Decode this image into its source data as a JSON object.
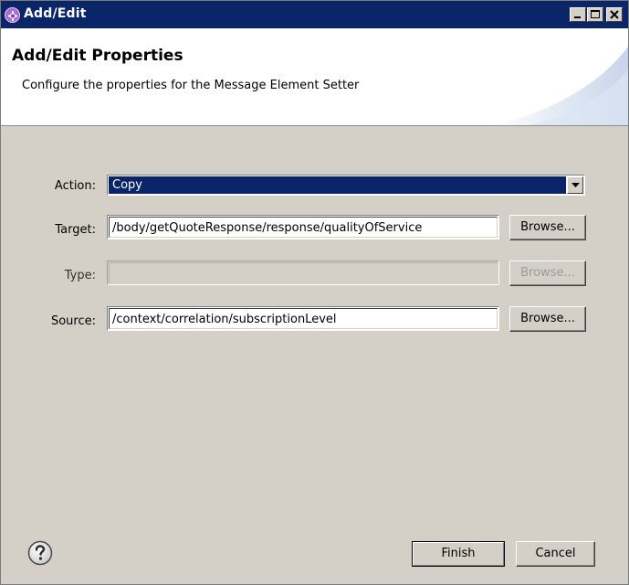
{
  "window": {
    "title": "Add/Edit",
    "icon": "service-mediation-icon"
  },
  "header": {
    "title": "Add/Edit Properties",
    "description": "Configure the properties for the Message Element Setter"
  },
  "form": {
    "action": {
      "label": "Action:",
      "value": "Copy"
    },
    "target": {
      "label": "Target:",
      "value": "/body/getQuoteResponse/response/qualityOfService",
      "browse_label": "Browse..."
    },
    "type": {
      "label": "Type:",
      "value": "",
      "browse_label": "Browse...",
      "disabled": true
    },
    "source": {
      "label": "Source:",
      "value": "/context/correlation/subscriptionLevel",
      "browse_label": "Browse..."
    }
  },
  "footer": {
    "help_icon": "question-mark-icon",
    "finish_label": "Finish",
    "cancel_label": "Cancel"
  },
  "colors": {
    "titlebar": "#0b2569",
    "selection": "#0a246a",
    "dialog_bg": "#d4d0c8"
  }
}
